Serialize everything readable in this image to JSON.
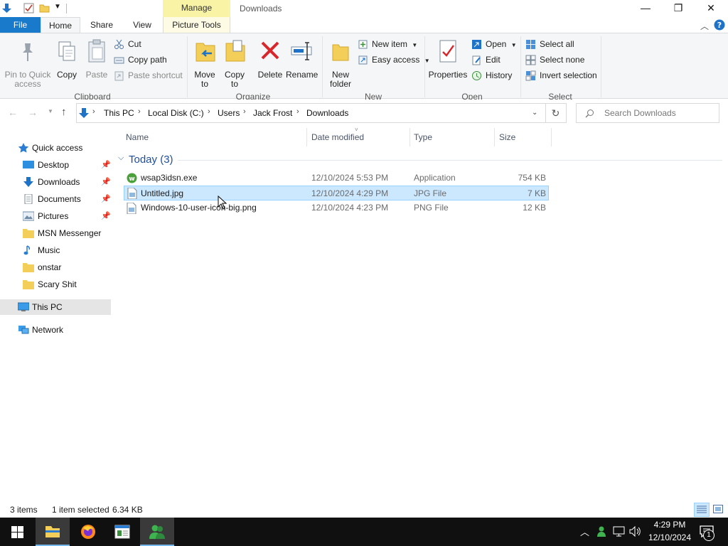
{
  "titlebar": {
    "context_tab": "Manage",
    "window_title": "Downloads",
    "minimize": "—",
    "restore": "❐",
    "close": "✕"
  },
  "tabs": {
    "file": "File",
    "home": "Home",
    "share": "Share",
    "view": "View",
    "picture_tools": "Picture Tools"
  },
  "ribbon": {
    "clipboard": {
      "pin": "Pin to Quick access",
      "copy": "Copy",
      "paste": "Paste",
      "cut": "Cut",
      "copy_path": "Copy path",
      "paste_shortcut": "Paste shortcut",
      "group": "Clipboard"
    },
    "organize": {
      "move_to": "Move to",
      "copy_to": "Copy to",
      "delete": "Delete",
      "rename": "Rename",
      "group": "Organize"
    },
    "new": {
      "new_folder": "New folder",
      "new_item": "New item",
      "easy_access": "Easy access",
      "group": "New"
    },
    "open": {
      "properties": "Properties",
      "open": "Open",
      "edit": "Edit",
      "history": "History",
      "group": "Open"
    },
    "select": {
      "select_all": "Select all",
      "select_none": "Select none",
      "invert": "Invert selection",
      "group": "Select"
    }
  },
  "address": {
    "crumbs": [
      "This PC",
      "Local Disk (C:)",
      "Users",
      "Jack Frost",
      "Downloads"
    ],
    "search_placeholder": "Search Downloads"
  },
  "nav": {
    "quick_access": "Quick access",
    "items": [
      "Desktop",
      "Downloads",
      "Documents",
      "Pictures",
      "MSN Messenger",
      "Music",
      "onstar",
      "Scary Shit"
    ],
    "this_pc": "This PC",
    "network": "Network"
  },
  "columns": {
    "name": "Name",
    "date": "Date modified",
    "type": "Type",
    "size": "Size"
  },
  "group_header": "Today (3)",
  "files": [
    {
      "name": "wsap3idsn.exe",
      "date": "12/10/2024 5:53 PM",
      "type": "Application",
      "size": "754 KB"
    },
    {
      "name": "Untitled.jpg",
      "date": "12/10/2024 4:29 PM",
      "type": "JPG File",
      "size": "7 KB"
    },
    {
      "name": "Windows-10-user-icon-big.png",
      "date": "12/10/2024 4:23 PM",
      "type": "PNG File",
      "size": "12 KB"
    }
  ],
  "status": {
    "items": "3 items",
    "selected": "1 item selected",
    "size": "6.34 KB"
  },
  "clock": {
    "time": "4:29 PM",
    "date": "12/10/2024"
  },
  "notification_count": "1",
  "colors": {
    "accent": "#1979ca",
    "selection": "#cce8ff",
    "manage_tab": "#f9f3a6",
    "taskbar": "#101010"
  }
}
